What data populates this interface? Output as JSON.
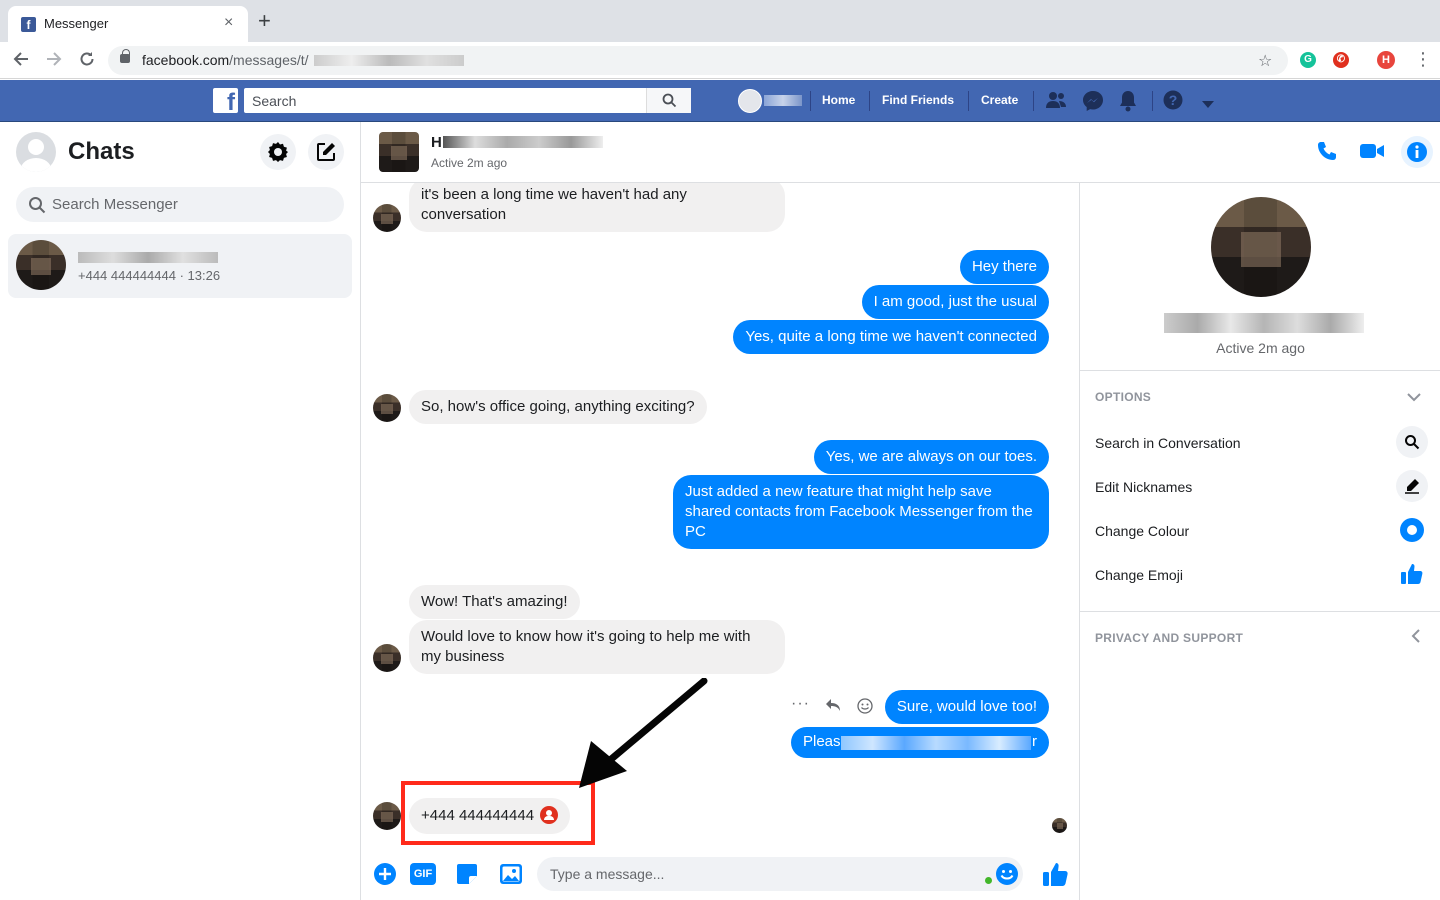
{
  "browser": {
    "tab_title": "Messenger",
    "tab_close": "×",
    "new_tab": "+",
    "url_visible": "facebook.com/messages/t/",
    "url_domain": "facebook.com",
    "url_path": "/messages/t/",
    "profile_initial": "H"
  },
  "fb_bar": {
    "logo_letter": "f",
    "search_placeholder": "Search",
    "nav": [
      "Home",
      "Find Friends",
      "Create"
    ]
  },
  "sidebar": {
    "title": "Chats",
    "search_placeholder": "Search Messenger",
    "conversations": [
      {
        "subtitle": "+444 444444444 · 13:26"
      }
    ]
  },
  "conversation": {
    "status": "Active 2m ago",
    "name_initial": "H",
    "messages": [
      {
        "dir": "in",
        "text": "it's been a long time we haven't had any conversation"
      },
      {
        "dir": "out",
        "text": "Hey there"
      },
      {
        "dir": "out",
        "text": "I am good, just the usual"
      },
      {
        "dir": "out",
        "text": "Yes, quite a long time we haven't connected"
      },
      {
        "dir": "in",
        "text": "So, how's office going, anything exciting?"
      },
      {
        "dir": "out",
        "text": "Yes, we are always on our toes."
      },
      {
        "dir": "out",
        "text": "Just added a new feature that might help save shared contacts from Facebook Messenger from the PC"
      },
      {
        "dir": "in",
        "text": "Wow! That's amazing!"
      },
      {
        "dir": "in",
        "text": "Would love to know how it's going to help me with my business"
      },
      {
        "dir": "out",
        "text": "Sure, would love too!"
      }
    ],
    "blurred_message": {
      "start": "Pleas",
      "end": "r"
    },
    "shared_contact": "+444 444444444"
  },
  "composer": {
    "placeholder": "Type a message...",
    "gif_label": "GIF"
  },
  "info_panel": {
    "status": "Active 2m ago",
    "options_header": "OPTIONS",
    "options": [
      "Search in Conversation",
      "Edit Nicknames",
      "Change Colour",
      "Change Emoji"
    ],
    "privacy_header": "PRIVACY AND SUPPORT"
  },
  "colors": {
    "fb_blue": "#4267b2",
    "messenger_blue": "#0084ff",
    "highlight_red": "#ff2a1a"
  }
}
